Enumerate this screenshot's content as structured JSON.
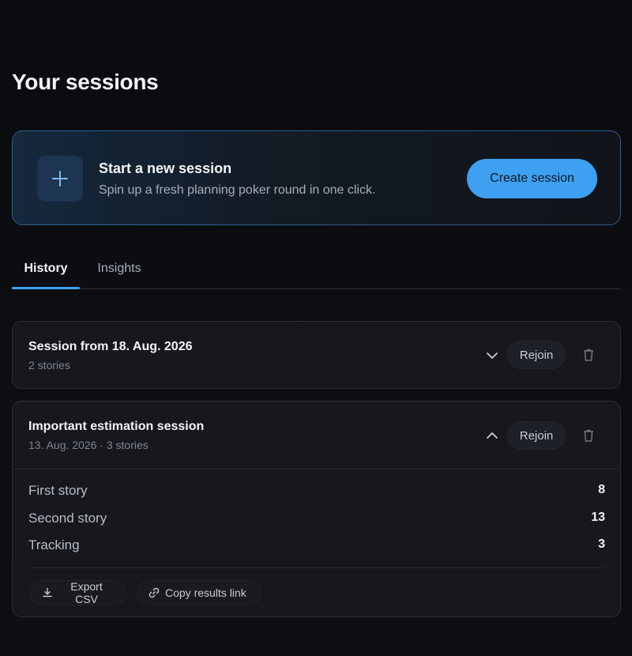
{
  "page": {
    "title": "Your sessions"
  },
  "new_session": {
    "title": "Start a new session",
    "subtitle": "Spin up a fresh planning poker round in one click.",
    "create_label": "Create session",
    "icon": "plus-icon"
  },
  "tabs": [
    {
      "label": "History",
      "active": true
    },
    {
      "label": "Insights",
      "active": false
    }
  ],
  "sessions": [
    {
      "title": "Session from 18. Aug. 2026",
      "meta": "2 stories",
      "expanded": false,
      "rejoin_label": "Rejoin"
    },
    {
      "title": "Important estimation session",
      "meta": "13. Aug. 2026 · 3 stories",
      "expanded": true,
      "rejoin_label": "Rejoin",
      "stories": [
        {
          "name": "First story",
          "points": "8"
        },
        {
          "name": "Second story",
          "points": "13"
        },
        {
          "name": "Tracking",
          "points": "3"
        }
      ],
      "actions": {
        "export_label": "Export CSV",
        "copy_label": "Copy results link"
      }
    }
  ],
  "colors": {
    "accent": "#3ea0f0",
    "background": "#0b0d11",
    "card": "#16181d",
    "muted_text": "#7e848e"
  }
}
